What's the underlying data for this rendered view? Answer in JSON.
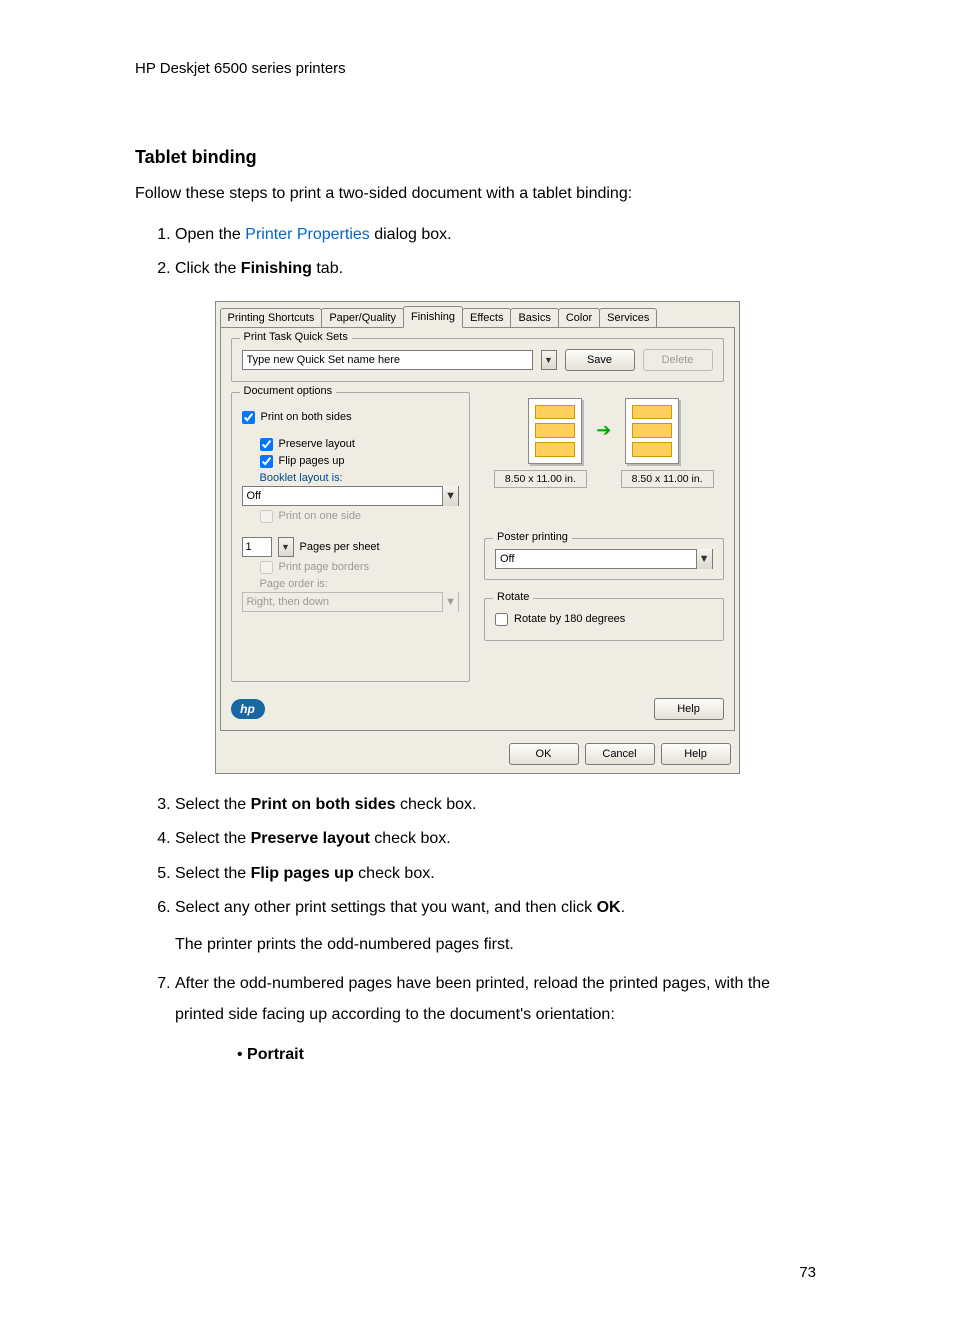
{
  "header": "HP Deskjet 6500 series printers",
  "section_title": "Tablet binding",
  "intro": "Follow these steps to print a two-sided document with a tablet binding:",
  "steps": {
    "s1_a": "Open the ",
    "s1_link": "Printer Properties",
    "s1_b": " dialog box.",
    "s2_a": "Click the ",
    "s2_bold": "Finishing",
    "s2_b": " tab.",
    "s3_a": "Select the ",
    "s3_bold": "Print on both sides",
    "s3_b": " check box.",
    "s4_a": "Select the ",
    "s4_bold": "Preserve layout",
    "s4_b": " check box.",
    "s5_a": "Select the ",
    "s5_bold": "Flip pages up",
    "s5_b": " check box.",
    "s6_a": "Select any other print settings that you want, and then click ",
    "s6_bold": "OK",
    "s6_b": ".",
    "s6_para": "The printer prints the odd-numbered pages first.",
    "s7": "After the odd-numbered pages have been printed, reload the printed pages, with the printed side facing up according to the document's orientation:",
    "s7_bullet": "Portrait"
  },
  "dialog": {
    "tabs": [
      "Printing Shortcuts",
      "Paper/Quality",
      "Finishing",
      "Effects",
      "Basics",
      "Color",
      "Services"
    ],
    "active_tab_index": 2,
    "quicksets": {
      "group_title": "Print Task Quick Sets",
      "placeholder": "Type new Quick Set name here",
      "save": "Save",
      "delete": "Delete"
    },
    "docopts": {
      "group_title": "Document options",
      "print_both": "Print on both sides",
      "preserve": "Preserve layout",
      "flip": "Flip pages up",
      "booklet_label": "Booklet layout is:",
      "booklet_value": "Off",
      "print_one_side": "Print on one side",
      "pages_per_sheet_label": "Pages per sheet",
      "pages_per_sheet_value": "1",
      "print_borders": "Print page borders",
      "page_order_label": "Page order is:",
      "page_order_value": "Right, then down"
    },
    "preview": {
      "dim1": "8.50 x 11.00 in.",
      "dim2": "8.50 x 11.00 in."
    },
    "poster": {
      "group_title": "Poster printing",
      "value": "Off"
    },
    "rotate": {
      "group_title": "Rotate",
      "label": "Rotate by 180 degrees"
    },
    "help_inner": "Help",
    "hp_badge": "hp",
    "ok": "OK",
    "cancel": "Cancel",
    "help": "Help"
  },
  "page_number": "73"
}
